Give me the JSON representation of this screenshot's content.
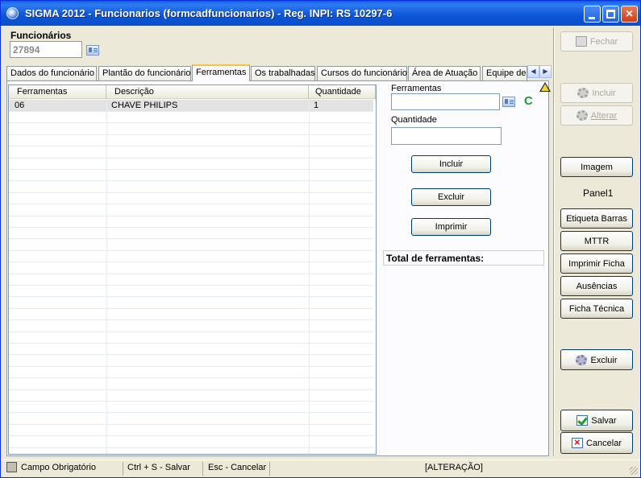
{
  "window": {
    "title": "SIGMA 2012 - Funcionarios  (formcadfuncionarios)  - Reg. INPI: RS 10297-6"
  },
  "header": {
    "label": "Funcionários",
    "code": "27894"
  },
  "tabs": [
    {
      "label": "Dados do funcionário"
    },
    {
      "label": "Plantão do funcionário"
    },
    {
      "label": "Ferramentas"
    },
    {
      "label": "Os trabalhadas"
    },
    {
      "label": "Cursos do funcionário"
    },
    {
      "label": "Área de Atuação"
    },
    {
      "label": "Equipe de"
    }
  ],
  "grid": {
    "columns": [
      "Ferramentas",
      "Descrição",
      "Quantidade"
    ],
    "rows": [
      {
        "ferramenta": "06",
        "descricao": "CHAVE PHILIPS",
        "quantidade": "1"
      }
    ]
  },
  "form": {
    "ferramentas_label": "Ferramentas",
    "ferramentas_value": "",
    "clear_glyph": "C",
    "quantidade_label": "Quantidade",
    "quantidade_value": "",
    "incluir": "Incluir",
    "excluir": "Excluir",
    "imprimir": "Imprimir",
    "total_label": "Total de ferramentas:"
  },
  "sidebar": {
    "fechar": "Fechar",
    "incluir": "Incluir",
    "alterar": "Alterar",
    "imagem": "Imagem",
    "panel": "Panel1",
    "etiqueta": "Etiqueta Barras",
    "mttr": "MTTR",
    "imprimir_ficha": "Imprimir Ficha",
    "ausencias": "Ausências",
    "ficha_tecnica": "Ficha Técnica",
    "excluir": "Excluir",
    "salvar": "Salvar",
    "cancelar": "Cancelar"
  },
  "statusbar": {
    "required": "Campo Obrigatório",
    "save_hint": "Ctrl + S - Salvar",
    "cancel_hint": "Esc - Cancelar",
    "mode": "[ALTERAÇÃO]"
  },
  "icons": {
    "app": "app-icon",
    "minimize": "minimize-icon",
    "maximize": "maximize-icon",
    "close": "close-icon",
    "warning": "warning-icon"
  },
  "colors": {
    "titlebar": "#0a5fe0",
    "window_bg": "#ece9d8",
    "active_tab_accent": "#f5c245"
  }
}
